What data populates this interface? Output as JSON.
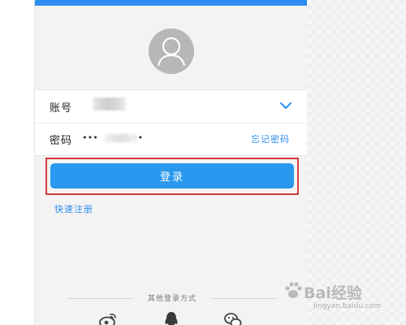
{
  "login": {
    "account_label": "账号",
    "password_label": "密码",
    "password_mask": "•••",
    "password_mask_tail": "••",
    "forgot_password": "忘记密码",
    "login_button": "登录",
    "quick_register": "快速注册",
    "other_login_methods": "其他登录方式"
  },
  "social_icons": [
    "weibo-icon",
    "qq-icon",
    "wechat-icon"
  ],
  "colors": {
    "accent": "#2d8df0",
    "login_button": "#2a98ee",
    "highlight_box": "#d93a3a",
    "avatar": "#b7b7b7"
  },
  "watermark": {
    "brand": "Bai经验",
    "url": "jingyan.baidu.com"
  }
}
